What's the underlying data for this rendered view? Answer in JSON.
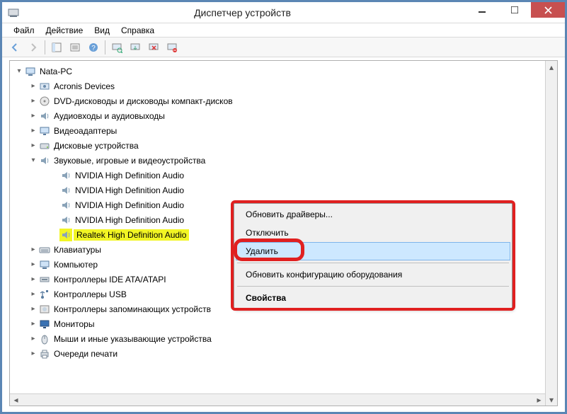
{
  "window": {
    "title": "Диспетчер устройств"
  },
  "menubar": {
    "file": "Файл",
    "action": "Действие",
    "view": "Вид",
    "help": "Справка"
  },
  "tree": {
    "root": "Nata-PC",
    "categories": [
      {
        "label": "Acronis Devices",
        "expanded": false,
        "icon": "device"
      },
      {
        "label": "DVD-дисководы и дисководы компакт-дисков",
        "expanded": false,
        "icon": "disc"
      },
      {
        "label": "Аудиовходы и аудиовыходы",
        "expanded": false,
        "icon": "audio"
      },
      {
        "label": "Видеоадаптеры",
        "expanded": false,
        "icon": "display"
      },
      {
        "label": "Дисковые устройства",
        "expanded": false,
        "icon": "disk"
      },
      {
        "label": "Звуковые, игровые и видеоустройства",
        "expanded": true,
        "icon": "audio",
        "children": [
          {
            "label": "NVIDIA High Definition Audio",
            "icon": "audio"
          },
          {
            "label": "NVIDIA High Definition Audio",
            "icon": "audio"
          },
          {
            "label": "NVIDIA High Definition Audio",
            "icon": "audio"
          },
          {
            "label": "NVIDIA High Definition Audio",
            "icon": "audio"
          },
          {
            "label": "Realtek High Definition Audio",
            "icon": "audio",
            "highlighted": true
          }
        ]
      },
      {
        "label": "Клавиатуры",
        "expanded": false,
        "icon": "keyboard"
      },
      {
        "label": "Компьютер",
        "expanded": false,
        "icon": "computer"
      },
      {
        "label": "Контроллеры IDE ATA/ATAPI",
        "expanded": false,
        "icon": "ide"
      },
      {
        "label": "Контроллеры USB",
        "expanded": false,
        "icon": "usb"
      },
      {
        "label": "Контроллеры запоминающих устройств",
        "expanded": false,
        "icon": "storage"
      },
      {
        "label": "Мониторы",
        "expanded": false,
        "icon": "monitor"
      },
      {
        "label": "Мыши и иные указывающие устройства",
        "expanded": false,
        "icon": "mouse"
      },
      {
        "label": "Очереди печати",
        "expanded": false,
        "icon": "printer"
      }
    ]
  },
  "context_menu": {
    "items": [
      {
        "label": "Обновить драйверы...",
        "bold": false
      },
      {
        "label": "Отключить",
        "bold": false
      },
      {
        "label": "Удалить",
        "bold": false,
        "hover": true
      },
      {
        "sep": true
      },
      {
        "label": "Обновить конфигурацию оборудования",
        "bold": false
      },
      {
        "sep": true
      },
      {
        "label": "Свойства",
        "bold": true
      }
    ]
  }
}
